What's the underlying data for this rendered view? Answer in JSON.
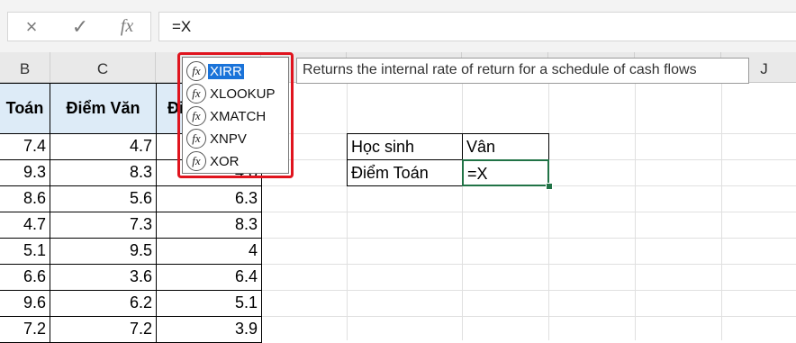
{
  "formula_bar": {
    "cancel_icon": "×",
    "enter_icon": "✓",
    "fx_label": "fx",
    "value": "=X"
  },
  "columns": [
    "B",
    "C",
    "",
    "",
    "",
    "",
    "",
    "J"
  ],
  "table": {
    "headers": [
      "Toán",
      "Điểm Văn",
      "Đi"
    ],
    "rows": [
      [
        "7.4",
        "4.7",
        ""
      ],
      [
        "9.3",
        "8.3",
        "4.8"
      ],
      [
        "8.6",
        "5.6",
        "6.3"
      ],
      [
        "4.7",
        "7.3",
        "8.3"
      ],
      [
        "5.1",
        "9.5",
        "4"
      ],
      [
        "6.6",
        "3.6",
        "6.4"
      ],
      [
        "9.6",
        "6.2",
        "5.1"
      ],
      [
        "7.2",
        "7.2",
        "3.9"
      ]
    ]
  },
  "side_table": {
    "r1_label": "Học sinh",
    "r1_value": "Vân",
    "r2_label": "Điểm Toán",
    "r2_value": "=X"
  },
  "autocomplete": {
    "items": [
      "XIRR",
      "XLOOKUP",
      "XMATCH",
      "XNPV",
      "XOR"
    ],
    "selected_index": 0,
    "tooltip": "Returns the internal rate of return for a schedule of cash flows"
  },
  "colors": {
    "highlight_border": "#e0141e",
    "header_fill": "#ddebf7",
    "selection": "#1a73d9",
    "active_cell_border": "#217346"
  }
}
